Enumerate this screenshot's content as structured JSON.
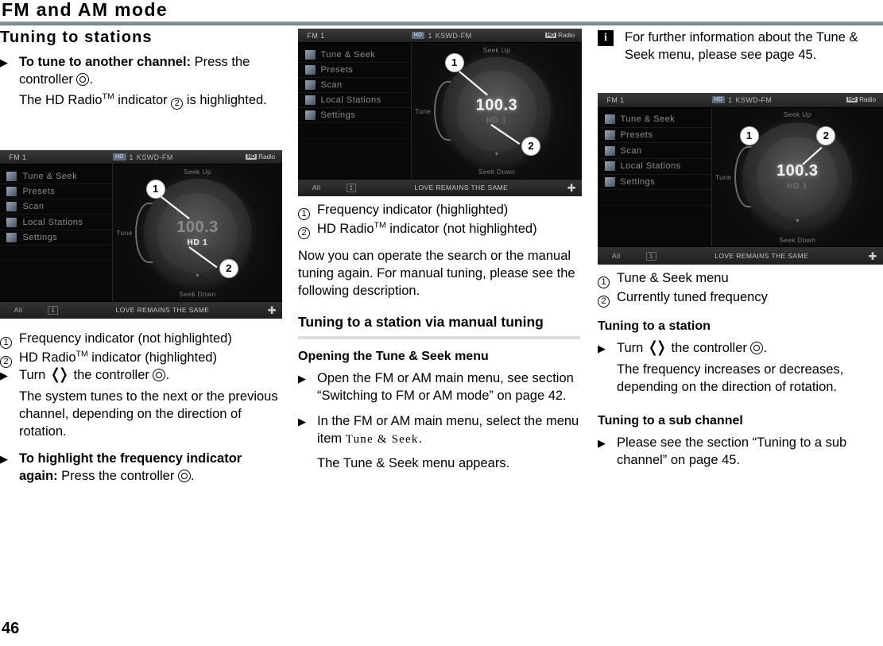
{
  "header": {
    "title": "FM and AM mode"
  },
  "footer": {
    "page_number": "46"
  },
  "column1": {
    "section_title": "Tuning to stations",
    "step1": {
      "bold_lead": "To tune to another channel:",
      "rest": " Press the controller ",
      "after": "."
    },
    "result1_a": "The HD Radio",
    "result1_sup": "TM",
    "result1_b": " indicator ",
    "result1_c": " is highlighted.",
    "legend": [
      {
        "key": "1",
        "label": "Frequency indicator (not highlighted)"
      },
      {
        "key": "2",
        "label_a": "HD Radio",
        "label_sup": "TM",
        "label_b": " indicator (highlighted)"
      }
    ],
    "step2_a": "Turn ",
    "step2_b": " the controller ",
    "step2_c": ".",
    "result2": "The system tunes to the next or the previous channel, depending on the direction of rotation.",
    "step3": {
      "bold_lead": "To highlight the frequency indicator again:",
      "rest": " Press the controller ",
      "after": "."
    }
  },
  "column2": {
    "legend": [
      {
        "key": "1",
        "label": "Frequency indicator (highlighted)"
      },
      {
        "key": "2",
        "label_a": "HD Radio",
        "label_sup": "TM",
        "label_b": " indicator (not highlighted)"
      }
    ],
    "paragraph": "Now you can operate the search or the manual tuning again. For manual tuning, please see the following description.",
    "section_title": "Tuning to a station via manual tuning",
    "minor_title": "Opening the Tune & Seek menu",
    "step1": "Open the FM or AM main menu, see section “Switching to FM or AM mode” on page 42.",
    "step2_a": "In the FM or AM main menu, select the menu item ",
    "step2_item": "Tune & Seek",
    "step2_b": ".",
    "result2": "The Tune & Seek menu appears."
  },
  "column3": {
    "note": {
      "icon": "info-icon",
      "icon_glyph": "i",
      "text": "For further information about the Tune & Seek menu, please see page 45."
    },
    "legend": [
      {
        "key": "1",
        "label": "Tune & Seek menu"
      },
      {
        "key": "2",
        "label": "Currently tuned frequency"
      }
    ],
    "minor_title_1": "Tuning to a station",
    "step1_a": "Turn ",
    "step1_b": " the controller ",
    "step1_c": ".",
    "result1": "The frequency increases or decreases, depending on the direction of rotation.",
    "minor_title_2": "Tuning to a sub channel",
    "step2": "Please see the section “Tuning to a sub channel” on page 45."
  },
  "radio_ui": {
    "topbar": {
      "source": "FM 1",
      "chip": "HD",
      "preset": "1",
      "call_sign": "KSWD-FM",
      "brand": "HD",
      "brand_text": "Radio"
    },
    "menu_items": [
      "Tune & Seek",
      "Presets",
      "Scan",
      "Local Stations",
      "Settings"
    ],
    "dial": {
      "seek_up": "Seek Up",
      "seek_down": "Seek Down",
      "tune": "Tune",
      "frequency": "100.3",
      "hd_channel": "HD 1"
    },
    "bottombar": {
      "left": "All",
      "badge": "1",
      "track": "LOVE REMAINS THE SAME"
    }
  },
  "figures": {
    "fig1": {
      "name": "radio-screenshot-frequency-not-highlighted",
      "callout_1": "1",
      "callout_2": "2"
    },
    "fig2": {
      "name": "radio-screenshot-frequency-highlighted",
      "callout_1": "1",
      "callout_2": "2"
    },
    "fig3": {
      "name": "radio-screenshot-tune-and-seek-menu",
      "callout_1": "1",
      "callout_2": "2"
    }
  },
  "colors": {
    "header_rule": "#7f9093",
    "sub_rule": "#d9dee0",
    "screen_bg": "#0a0a0a"
  }
}
